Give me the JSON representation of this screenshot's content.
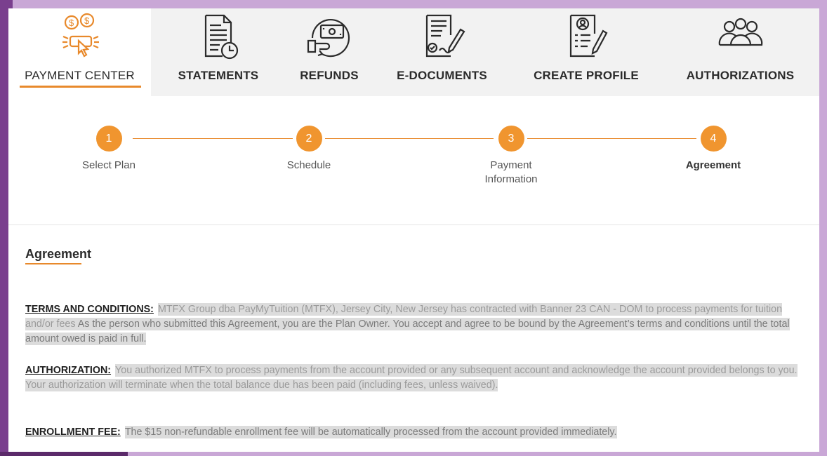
{
  "nav": {
    "items": [
      {
        "label": "PAYMENT CENTER",
        "icon": "payment-center-icon",
        "active": true
      },
      {
        "label": "STATEMENTS",
        "icon": "statements-icon"
      },
      {
        "label": "REFUNDS",
        "icon": "refunds-icon"
      },
      {
        "label": "E-DOCUMENTS",
        "icon": "e-documents-icon"
      },
      {
        "label": "CREATE PROFILE",
        "icon": "create-profile-icon"
      },
      {
        "label": "AUTHORIZATIONS",
        "icon": "authorizations-icon"
      }
    ],
    "accent_color": "#e8892b"
  },
  "stepper": {
    "steps": [
      {
        "number": "1",
        "label": "Select Plan"
      },
      {
        "number": "2",
        "label": "Schedule"
      },
      {
        "number": "3",
        "label": "Payment Information"
      },
      {
        "number": "4",
        "label": "Agreement",
        "current": true
      }
    ],
    "circle_color": "#f0952f"
  },
  "agreement": {
    "title": "Agreement",
    "terms": {
      "heading": "TERMS AND CONDITIONS:",
      "text": "MTFX Group dba PayMyTuition (MTFX), Jersey City, New Jersey has contracted with Banner 23 CAN - DOM to process payments for tuition and/or fees",
      "emphasis": "As the person who submitted this Agreement, you are the Plan Owner. You accept and agree to be bound by the Agreement’s terms and conditions until the total amount owed is paid in full."
    },
    "authorization": {
      "heading": "AUTHORIZATION:",
      "text": "You authorized MTFX to process payments from the account provided or any subsequent account and acknowledge the account provided belongs to you. Your authorization will terminate when the total balance due has been paid (including fees, unless waived)."
    },
    "enrollment_fee": {
      "heading": "ENROLLMENT FEE:",
      "text": "The $15 non-refundable enrollment fee will be automatically processed from the account provided immediately."
    }
  }
}
